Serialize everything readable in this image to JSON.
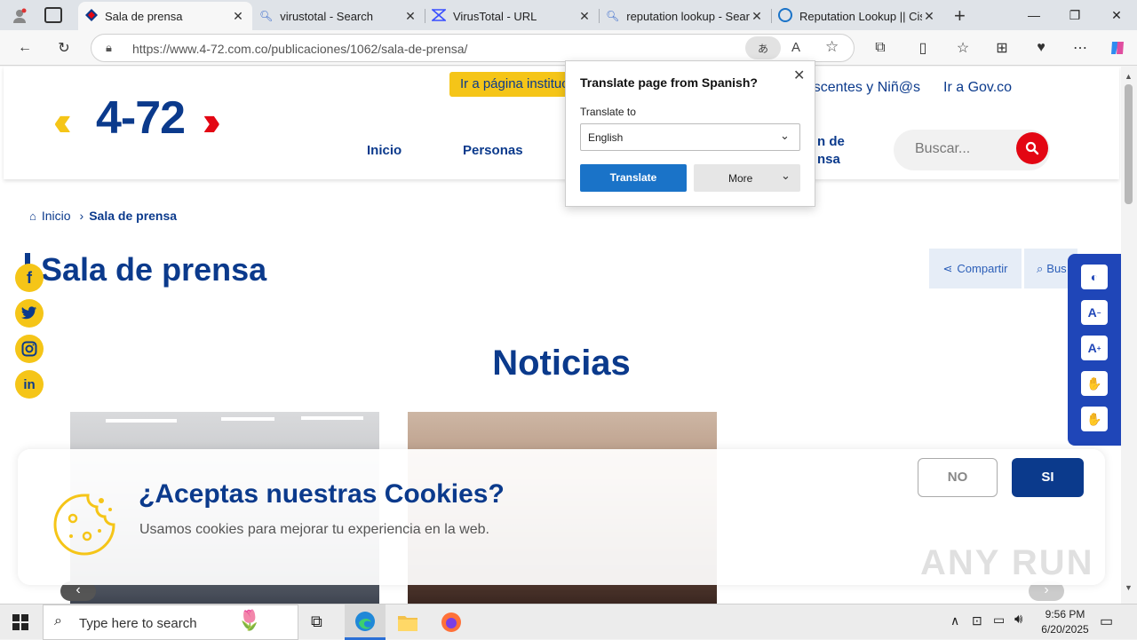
{
  "tabs": [
    {
      "title": "Sala de prensa",
      "active": true,
      "icon": "site-diamond-icon"
    },
    {
      "title": "virustotal - Search",
      "active": false,
      "icon": "search-icon"
    },
    {
      "title": "VirusTotal - URL",
      "active": false,
      "icon": "virustotal-icon"
    },
    {
      "title": "reputation lookup - Search",
      "active": false,
      "icon": "search-icon"
    },
    {
      "title": "Reputation Lookup || Cisco",
      "active": false,
      "icon": "cisco-icon"
    }
  ],
  "address": {
    "url": "https://www.4-72.com.co/publicaciones/1062/sala-de-prensa/"
  },
  "site": {
    "logo_text": "4-72",
    "top_banner": "Ir a página institucional",
    "top_links": [
      "Adolescentes y Niñ@s",
      "Ir a Gov.co"
    ],
    "nav": [
      "Inicio",
      "Personas"
    ],
    "nav_partial": [
      "n de",
      "nsa"
    ],
    "search_placeholder": "Buscar...",
    "breadcrumb": {
      "home": "Inicio",
      "current": "Sala de prensa"
    },
    "page_title": "Sala de prensa",
    "share_label": "Compartir",
    "search_btn_label": "Bus",
    "section_title": "Noticias"
  },
  "translate_popup": {
    "title": "Translate page from Spanish?",
    "label": "Translate to",
    "language": "English",
    "translate_btn": "Translate",
    "more_btn": "More"
  },
  "cookie": {
    "title": "¿Aceptas nuestras Cookies?",
    "text": "Usamos cookies para mejorar tu experiencia en la web.",
    "no_label": "NO",
    "yes_label": "SI"
  },
  "watermark": "ANY RUN",
  "taskbar": {
    "search_placeholder": "Type here to search",
    "time": "9:56 PM",
    "date": "6/20/2025"
  },
  "colors": {
    "brand_blue": "#0b3a8c",
    "brand_yellow": "#f5c518",
    "brand_red": "#e30613",
    "translate_blue": "#1a73c8",
    "access_blue": "#1f46b8"
  }
}
